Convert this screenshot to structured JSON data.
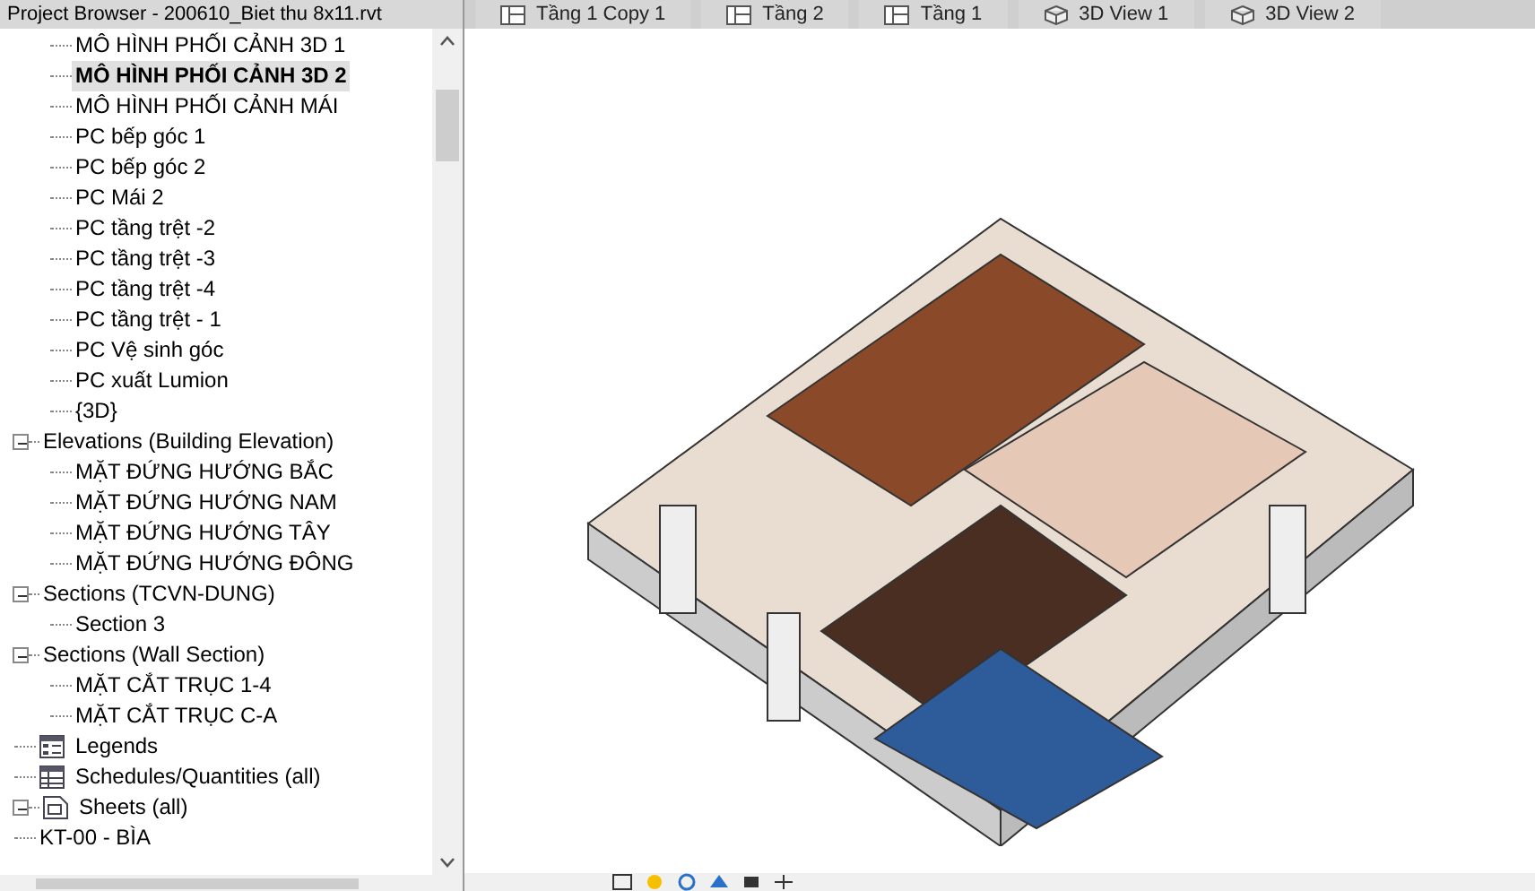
{
  "browser": {
    "title": "Project Browser - 200610_Biet thu 8x11.rvt",
    "tree": [
      {
        "children": [
          {
            "children": [
              {
                "label": "MÔ HÌNH PHỐI CẢNH 3D 1",
                "selected": false
              },
              {
                "label": "MÔ HÌNH PHỐI CẢNH 3D 2",
                "selected": true
              },
              {
                "label": "MÔ HÌNH PHỐI CẢNH MÁI",
                "selected": false
              },
              {
                "label": "PC bếp góc 1",
                "selected": false
              },
              {
                "label": "PC bếp góc 2",
                "selected": false
              },
              {
                "label": "PC Mái 2",
                "selected": false
              },
              {
                "label": "PC tầng trệt -2",
                "selected": false
              },
              {
                "label": "PC tầng trệt -3",
                "selected": false
              },
              {
                "label": "PC tầng trệt -4",
                "selected": false
              },
              {
                "label": "PC tầng trệt - 1",
                "selected": false
              },
              {
                "label": "PC Vệ sinh góc",
                "selected": false
              },
              {
                "label": "PC xuất Lumion",
                "selected": false
              },
              {
                "label": "{3D}",
                "selected": false
              }
            ]
          },
          {
            "label": "Elevations (Building Elevation)",
            "expanded": true,
            "children": [
              {
                "label": "MẶT ĐỨNG HƯỚNG BẮC",
                "selected": false
              },
              {
                "label": "MẶT ĐỨNG HƯỚNG NAM",
                "selected": false
              },
              {
                "label": "MẶT ĐỨNG HƯỚNG TÂY",
                "selected": false
              },
              {
                "label": "MẶT ĐỨNG HƯỚNG ĐÔNG",
                "selected": false
              }
            ]
          },
          {
            "label": "Sections (TCVN-DUNG)",
            "expanded": true,
            "children": [
              {
                "label": "Section 3",
                "selected": false
              }
            ]
          },
          {
            "label": "Sections (Wall Section)",
            "expanded": true,
            "children": [
              {
                "label": "MẶT CẮT TRỤC 1-4",
                "selected": false
              },
              {
                "label": "MẶT CẮT TRỤC C-A",
                "selected": false
              }
            ]
          }
        ]
      },
      {
        "label": "Legends",
        "kind": "legend"
      },
      {
        "label": "Schedules/Quantities (all)",
        "kind": "schedule"
      },
      {
        "label": "Sheets (all)",
        "kind": "sheet",
        "expanded": true,
        "children": [
          {
            "label": "KT-00 - BÌA",
            "selected": false
          }
        ]
      }
    ]
  },
  "view_tabs": [
    {
      "label": "Tầng 1 Copy 1",
      "kind": "plan"
    },
    {
      "label": "Tầng 2",
      "kind": "plan"
    },
    {
      "label": "Tầng 1",
      "kind": "plan"
    },
    {
      "label": "3D View 1",
      "kind": "cube"
    },
    {
      "label": "3D View 2",
      "kind": "cube"
    }
  ]
}
